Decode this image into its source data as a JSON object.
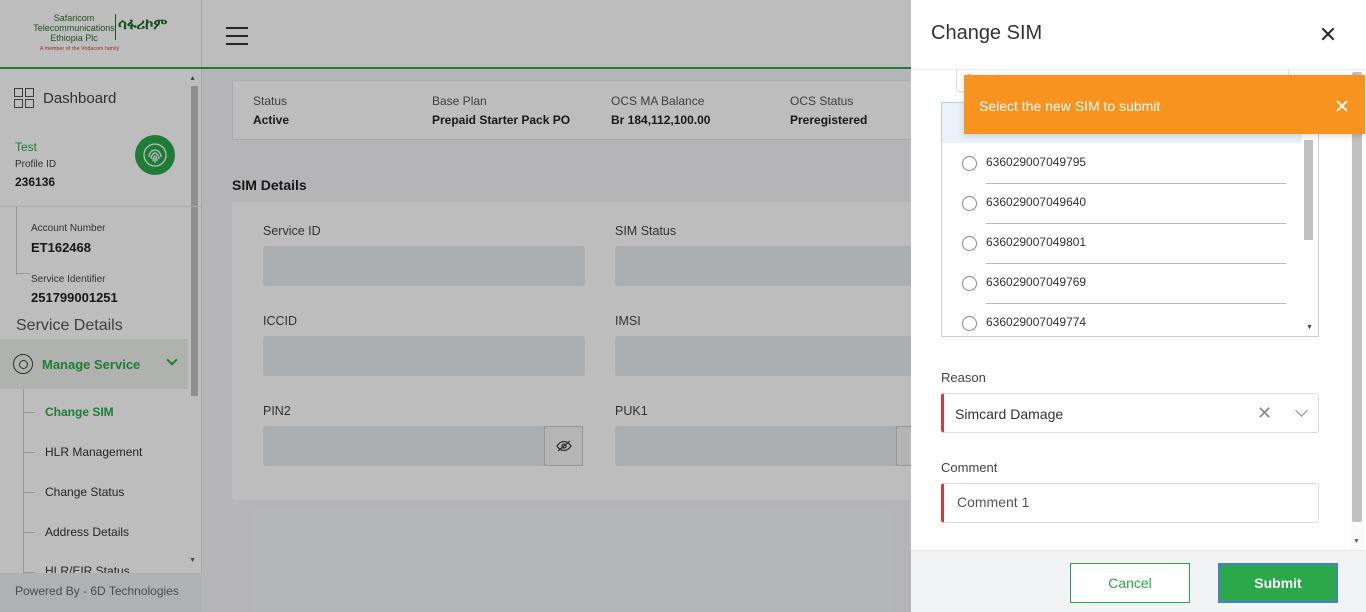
{
  "brand": {
    "line1": "Safaricom",
    "line2": "Telecommunications",
    "line3": "Ethiopia Plc",
    "amharic": "ሳፋሪኮም",
    "tagline": "A member of the Vodacom family"
  },
  "sidebar": {
    "dashboard": "Dashboard",
    "profile_name": "Test",
    "profile_id_label": "Profile ID",
    "profile_id": "236136",
    "account_number_label": "Account Number",
    "account_number": "ET162468",
    "service_identifier_label": "Service Identifier",
    "service_identifier": "251799001251",
    "service_details": "Service Details",
    "manage_service": "Manage Service",
    "subnav": [
      "Change SIM",
      "HLR Management",
      "Change Status",
      "Address Details",
      "HLR/EIR Status"
    ],
    "footer": "Powered By - 6D Technologies"
  },
  "status": {
    "items": [
      {
        "label": "Status",
        "value": "Active"
      },
      {
        "label": "Base Plan",
        "value": "Prepaid Starter Pack PO"
      },
      {
        "label": "OCS MA Balance",
        "value": "Br 184,112,100.00"
      },
      {
        "label": "OCS Status",
        "value": "Preregistered"
      }
    ]
  },
  "sim_details": {
    "title": "SIM Details",
    "fields": [
      "Service ID",
      "SIM Status",
      "ICCID",
      "IMSI",
      "PIN2",
      "PUK1"
    ]
  },
  "drawer": {
    "title": "Change SIM",
    "search_placeholder": "Search",
    "sims": [
      "636029007049795",
      "636029007049640",
      "636029007049801",
      "636029007049769",
      "636029007049774"
    ],
    "reason_label": "Reason",
    "reason_value": "Simcard Damage",
    "comment_label": "Comment",
    "comment_value": "Comment 1",
    "cancel": "Cancel",
    "submit": "Submit"
  },
  "toast": {
    "message": "Select the new SIM to submit",
    "color": "#f7931e"
  },
  "colors": {
    "accent": "#2ba84a",
    "required": "#d9363e"
  }
}
